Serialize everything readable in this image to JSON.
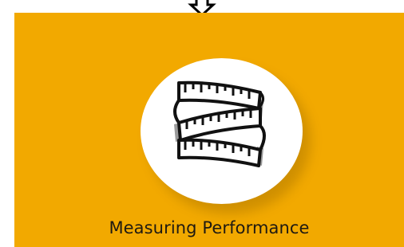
{
  "connector": {
    "icon": "down-arrow-icon"
  },
  "card": {
    "title": "Measuring Performance",
    "icon": "measuring-tape-icon",
    "background_color": "#f2a900",
    "circle_color": "#ffffff"
  }
}
